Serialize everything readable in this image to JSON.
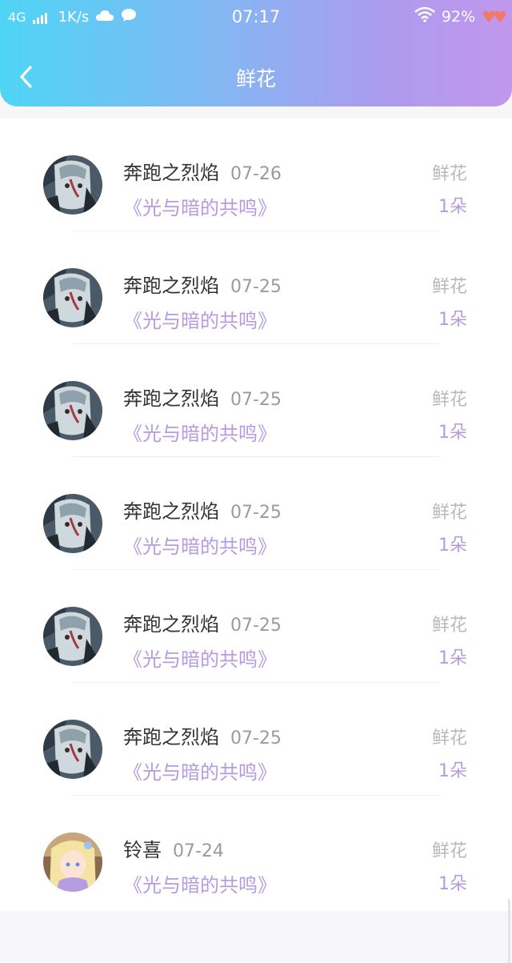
{
  "status_bar": {
    "network": "4G",
    "speed": "1K/s",
    "time": "07:17",
    "battery": "92%"
  },
  "nav": {
    "title": "鲜花",
    "back_icon": "chevron-left-icon"
  },
  "records": [
    {
      "username": "奔跑之烈焰",
      "date": "07-26",
      "work": "《光与暗的共鸣》",
      "gift_label": "鲜花",
      "gift_count": "1朵",
      "avatar": "anime-character-gray"
    },
    {
      "username": "奔跑之烈焰",
      "date": "07-25",
      "work": "《光与暗的共鸣》",
      "gift_label": "鲜花",
      "gift_count": "1朵",
      "avatar": "anime-character-gray"
    },
    {
      "username": "奔跑之烈焰",
      "date": "07-25",
      "work": "《光与暗的共鸣》",
      "gift_label": "鲜花",
      "gift_count": "1朵",
      "avatar": "anime-character-gray"
    },
    {
      "username": "奔跑之烈焰",
      "date": "07-25",
      "work": "《光与暗的共鸣》",
      "gift_label": "鲜花",
      "gift_count": "1朵",
      "avatar": "anime-character-gray"
    },
    {
      "username": "奔跑之烈焰",
      "date": "07-25",
      "work": "《光与暗的共鸣》",
      "gift_label": "鲜花",
      "gift_count": "1朵",
      "avatar": "anime-character-gray"
    },
    {
      "username": "奔跑之烈焰",
      "date": "07-25",
      "work": "《光与暗的共鸣》",
      "gift_label": "鲜花",
      "gift_count": "1朵",
      "avatar": "anime-character-gray"
    },
    {
      "username": "铃喜",
      "date": "07-24",
      "work": "《光与暗的共鸣》",
      "gift_label": "鲜花",
      "gift_count": "1朵",
      "avatar": "anime-character-pastel"
    }
  ],
  "colors": {
    "header_gradient_start": "#4fd5f6",
    "header_gradient_end": "#c197ec",
    "accent_purple": "#b79be0",
    "muted_gray": "#9b9b9b"
  }
}
